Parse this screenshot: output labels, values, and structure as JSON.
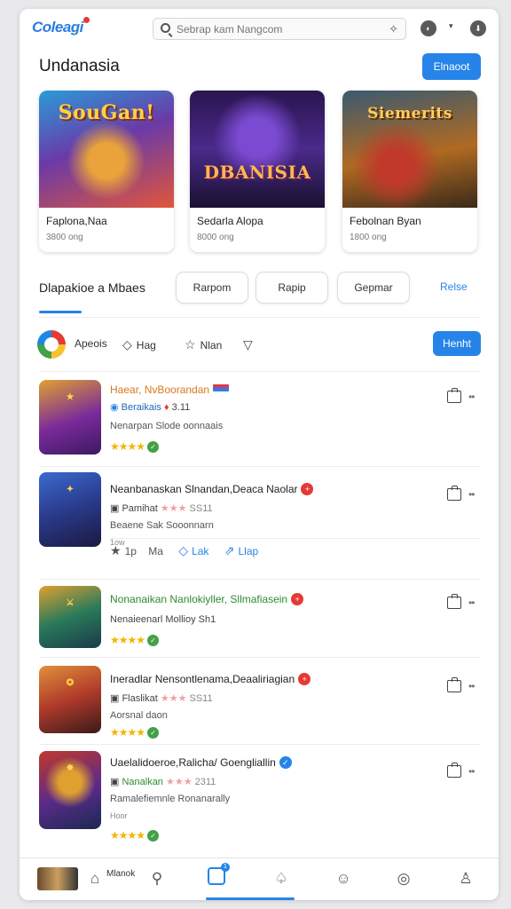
{
  "app": {
    "logo_text": "Coleagi",
    "search_placeholder": "Sebrap kam Nangcom"
  },
  "section": {
    "title": "Undanasia",
    "action_label": "Elnaoot"
  },
  "featured": [
    {
      "art_text": "SouGan!",
      "title": "Faplona,Naa",
      "subtitle": "3800 ong",
      "theme": "#2a9bd8"
    },
    {
      "art_text": "DBANISIA",
      "title": "Sedarla Alopa",
      "subtitle": "8000 ong",
      "theme": "#4a2a8a"
    },
    {
      "art_text": "Siemerits",
      "title": "Febolnan Byan",
      "subtitle": "1800 ong",
      "theme": "#b06a22"
    }
  ],
  "tabs": {
    "title": "Dlapakioe a Mbaes",
    "chips": [
      "Rarpom",
      "Rapip",
      "Gepmar"
    ],
    "link": "Relse"
  },
  "filters": {
    "items": [
      "Apeois",
      "Hag",
      "Nlan"
    ],
    "action_label": "Henht"
  },
  "list": [
    {
      "title": "Haear, NvBoorandan",
      "title_color": "orange",
      "meta": "Beraikais",
      "meta_extra": "3.11",
      "desc": "Nenarpan Slode oonnaais",
      "stars": "★★★★",
      "badge": "flag"
    },
    {
      "title": "Neanbanaskan Slnandan,Deaca Naolar",
      "title_color": "default",
      "meta": "Pamihat",
      "meta_extra": "SS11",
      "desc": "Beaene Sak Sooonnarn",
      "note": "1ow",
      "badge": "red"
    },
    {
      "title": "Nonanaikan Nanlokiyller, Sllmafiasein",
      "title_color": "green",
      "meta": "Nenaieenarl Mollioy Sh1",
      "meta_extra": "",
      "desc": "",
      "stars": "★★★★",
      "badge": "red"
    },
    {
      "title": "Ineradlar Nensontlenama,Deaaliriagian",
      "title_color": "default",
      "meta": "Flaslikat",
      "meta_extra": "SS11",
      "desc": "Aorsnal daon",
      "stars": "★★★★",
      "badge": "red"
    },
    {
      "title": "Uaelalidoeroe,Ralicha/ Goengliallin",
      "title_color": "default",
      "meta": "Nanalkan",
      "meta_extra": "2311",
      "desc": "Ramalefiemnle Ronanarally",
      "note": "Hoor",
      "stars": "★★★★",
      "badge": "blue"
    }
  ],
  "list_actions": {
    "like_count": "1p",
    "items": [
      "Ma",
      "Lak",
      "Llap"
    ]
  },
  "bottom_nav": {
    "label": "Mlanok"
  }
}
